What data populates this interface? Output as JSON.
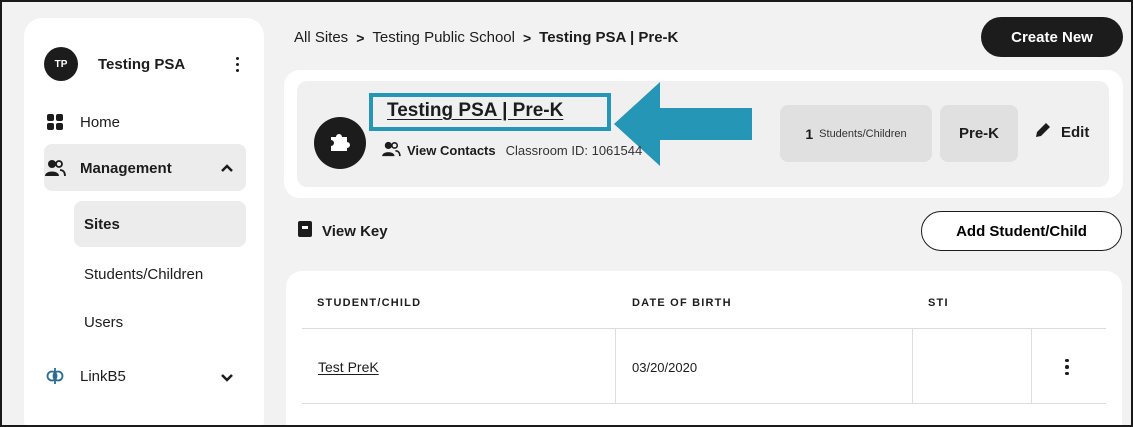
{
  "sidebar": {
    "avatar_initials": "TP",
    "user_name": "Testing PSA",
    "items": [
      {
        "label": "Home",
        "icon": "grid-icon"
      },
      {
        "label": "Management",
        "icon": "users-icon"
      },
      {
        "label": "LinkB5",
        "icon": "link-icon"
      }
    ],
    "sub_items": [
      {
        "label": "Sites"
      },
      {
        "label": "Students/Children"
      },
      {
        "label": "Users"
      }
    ]
  },
  "breadcrumb": {
    "items": [
      "All Sites",
      "Testing Public School",
      "Testing PSA | Pre-K"
    ],
    "separator": ">"
  },
  "header": {
    "create_label": "Create New"
  },
  "classroom": {
    "title": "Testing PSA | Pre-K",
    "view_contacts_label": "View Contacts",
    "classroom_id_text": "Classroom ID: 1061544",
    "student_count": "1",
    "student_count_label": "Students/Children",
    "grade": "Pre-K",
    "edit_label": "Edit"
  },
  "actions": {
    "view_key_label": "View Key",
    "add_label": "Add Student/Child"
  },
  "table": {
    "headers": [
      "STUDENT/CHILD",
      "DATE OF BIRTH",
      "STI"
    ],
    "rows": [
      {
        "name": "Test PreK",
        "dob": "03/20/2020",
        "sti": ""
      }
    ]
  },
  "colors": {
    "highlight": "#2596b5",
    "dark": "#1c1c1c"
  }
}
